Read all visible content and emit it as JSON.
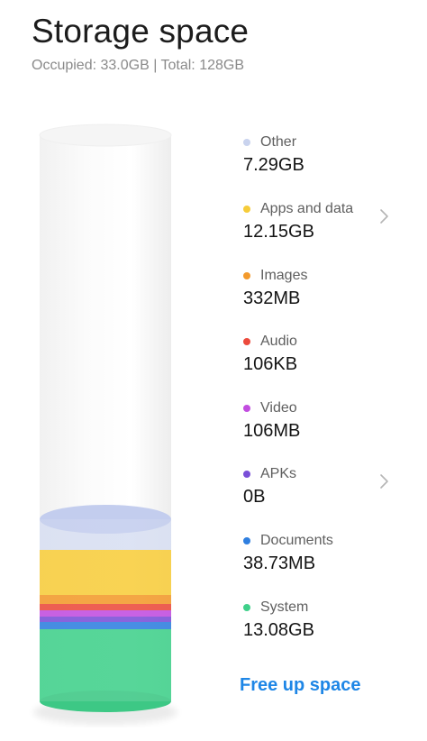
{
  "header": {
    "title": "Storage space",
    "summary": "Occupied: 33.0GB | Total: 128GB"
  },
  "legend": [
    {
      "label": "Other",
      "value": "7.29GB",
      "color": "#c9d3ee",
      "has_chevron": false
    },
    {
      "label": "Apps and data",
      "value": "12.15GB",
      "color": "#f6cc3a",
      "has_chevron": true
    },
    {
      "label": "Images",
      "value": "332MB",
      "color": "#f39a2c",
      "has_chevron": false
    },
    {
      "label": "Audio",
      "value": "106KB",
      "color": "#ec4a3c",
      "has_chevron": false
    },
    {
      "label": "Video",
      "value": "106MB",
      "color": "#c24de0",
      "has_chevron": false
    },
    {
      "label": "APKs",
      "value": "0B",
      "color": "#7a4fd8",
      "has_chevron": true
    },
    {
      "label": "Documents",
      "value": "38.73MB",
      "color": "#2f7fe0",
      "has_chevron": false
    },
    {
      "label": "System",
      "value": "13.08GB",
      "color": "#3fd08a",
      "has_chevron": false
    }
  ],
  "actions": {
    "free_up_label": "Free up space"
  },
  "colors": {
    "accent": "#1e86e6",
    "cylinder_empty": "#f7f7f7"
  }
}
